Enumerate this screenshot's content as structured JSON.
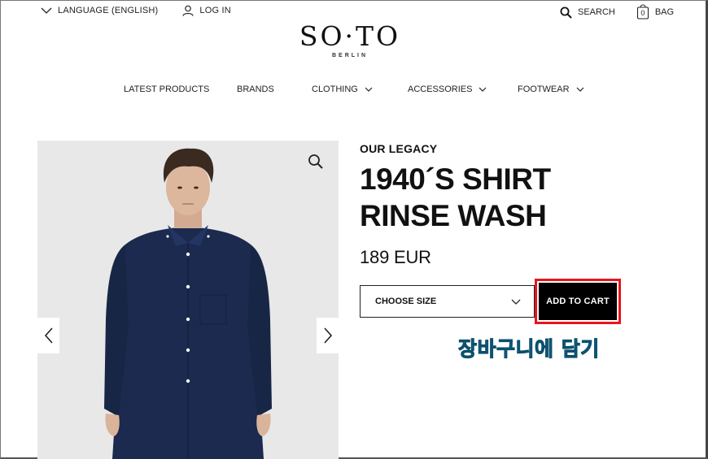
{
  "header": {
    "language_label": "LANGUAGE (ENGLISH)",
    "login_label": "LOG IN",
    "search_label": "SEARCH",
    "bag_label": "BAG",
    "bag_count": "0"
  },
  "logo": {
    "main": "SO·TO",
    "sub": "BERLIN"
  },
  "nav": {
    "items": [
      {
        "label": "LATEST PRODUCTS",
        "has_dropdown": false
      },
      {
        "label": "BRANDS",
        "has_dropdown": false
      },
      {
        "label": "CLOTHING",
        "has_dropdown": true
      },
      {
        "label": "ACCESSORIES",
        "has_dropdown": true
      },
      {
        "label": "FOOTWEAR",
        "has_dropdown": true
      }
    ]
  },
  "product": {
    "brand": "OUR LEGACY",
    "title": "1940´S SHIRT RINSE WASH",
    "price": "189 EUR",
    "size_placeholder": "CHOOSE SIZE",
    "add_to_cart_label": "ADD TO CART",
    "shirt_color": "#1b2a4e"
  },
  "annotation": {
    "text": "장바구니에 담기",
    "highlight_color": "#e8141c",
    "text_color": "#1f9ec9"
  }
}
